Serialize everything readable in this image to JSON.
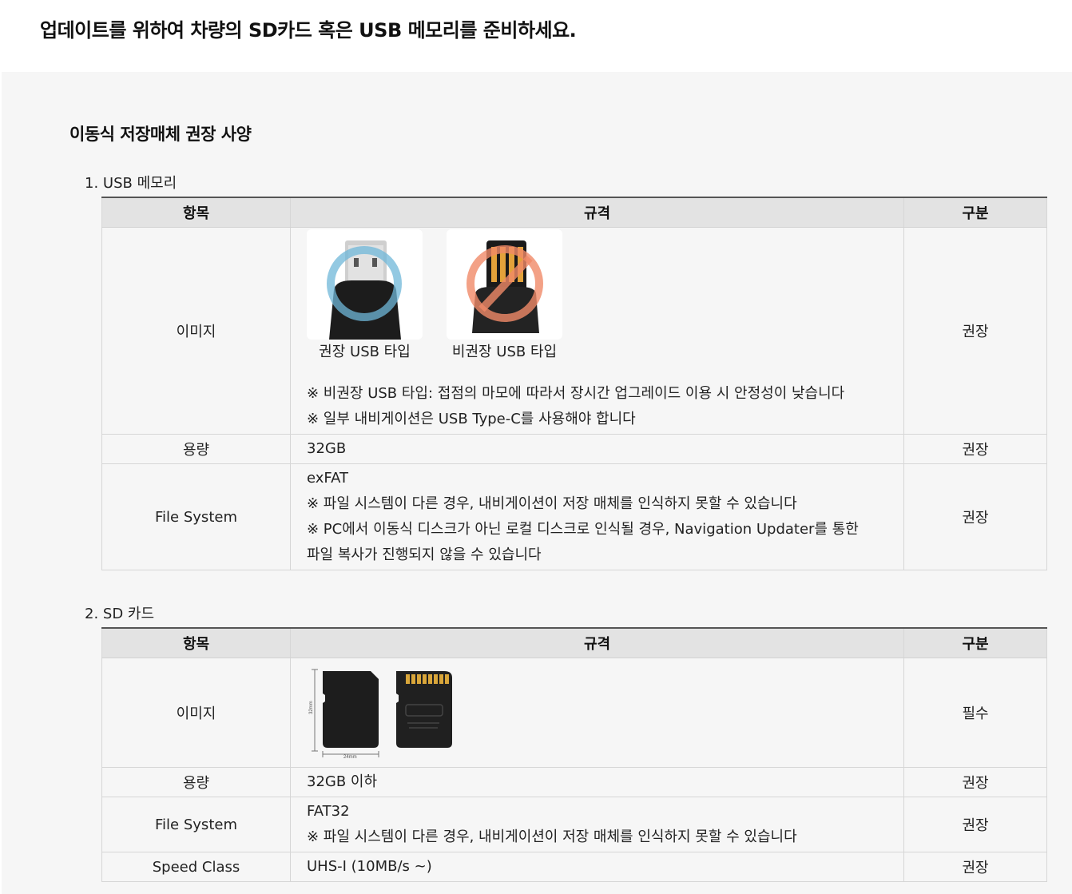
{
  "page_title": "업데이트를 위하여 차량의 SD카드 혹은 USB 메모리를 준비하세요.",
  "section_title": "이동식 저장매체 권장 사양",
  "table_headers": {
    "item": "항목",
    "spec": "규격",
    "category": "구분"
  },
  "usb": {
    "heading": "1. USB 메모리",
    "image_row": {
      "label": "이미지",
      "recommended_caption": "권장 USB 타입",
      "not_recommended_caption": "비권장 USB 타입",
      "note1": "※ 비권장 USB 타입: 접점의 마모에 따라서 장시간 업그레이드 이용 시 안정성이 낮습니다",
      "note2": "※ 일부 내비게이션은 USB Type-C를 사용해야 합니다",
      "category": "권장"
    },
    "capacity_row": {
      "label": "용량",
      "value": "32GB",
      "category": "권장"
    },
    "fs_row": {
      "label": "File System",
      "value": "exFAT",
      "note1": "※ 파일 시스템이 다른 경우, 내비게이션이 저장 매체를 인식하지 못할 수 있습니다",
      "note2a": "※ PC에서 이동식 디스크가 아닌 로컬 디스크로 인식될 경우, Navigation Updater를 통한",
      "note2b": "파일 복사가 진행되지 않을 수 있습니다",
      "category": "권장"
    }
  },
  "sd": {
    "heading": "2. SD 카드",
    "image_row": {
      "label": "이미지",
      "dim_height": "32mm",
      "dim_width": "24mm",
      "category": "필수"
    },
    "capacity_row": {
      "label": "용량",
      "value": "32GB 이하",
      "category": "권장"
    },
    "fs_row": {
      "label": "File System",
      "value": "FAT32",
      "note1": "※ 파일 시스템이 다른 경우, 내비게이션이 저장 매체를 인식하지 못할 수 있습니다",
      "category": "권장"
    },
    "speed_row": {
      "label": "Speed Class",
      "value": "UHS-I (10MB/s ~)",
      "category": "권장"
    }
  }
}
